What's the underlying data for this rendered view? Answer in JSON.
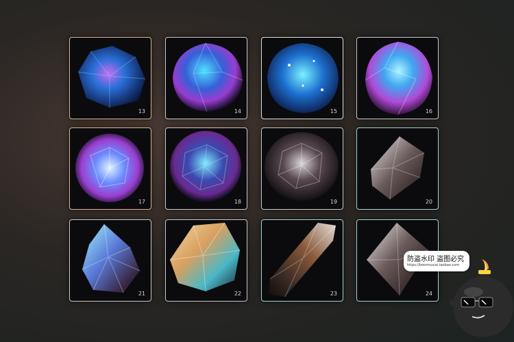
{
  "tiles": [
    {
      "number": "13",
      "shape": "blob-side",
      "hue": "cosmic-blue"
    },
    {
      "number": "14",
      "shape": "blob-round",
      "hue": "cosmic-blue"
    },
    {
      "number": "15",
      "shape": "blob-round",
      "hue": "cosmic-cyan"
    },
    {
      "number": "16",
      "shape": "blob-oval",
      "hue": "cosmic-blue"
    },
    {
      "number": "17",
      "shape": "sphere",
      "hue": "iridescent"
    },
    {
      "number": "18",
      "shape": "sphere",
      "hue": "cosmic-dark"
    },
    {
      "number": "19",
      "shape": "sphere",
      "hue": "smoky"
    },
    {
      "number": "20",
      "shape": "shard",
      "hue": "smoky"
    },
    {
      "number": "21",
      "shape": "crystal",
      "hue": "cyan-purple"
    },
    {
      "number": "22",
      "shape": "crystal-wide",
      "hue": "amber-cyan"
    },
    {
      "number": "23",
      "shape": "prism",
      "hue": "smoky-amber"
    },
    {
      "number": "24",
      "shape": "diamond",
      "hue": "smoky"
    }
  ],
  "watermark": {
    "line1": "防盗水印 盗图必究",
    "line2": "https://boomsucai.taobao.com"
  },
  "colors": {
    "tile_bg": "#0b0b0d",
    "border_light": "#c9c9c9",
    "border_warm": "#d7b48e",
    "border_cool": "#a8d4d4"
  }
}
